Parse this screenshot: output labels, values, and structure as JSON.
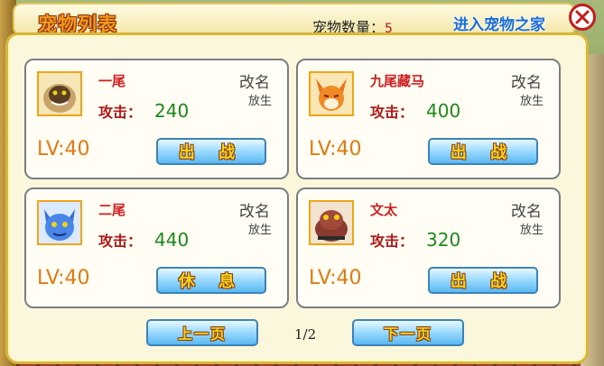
{
  "header": {
    "title": "宠物列表",
    "count_label": "宠物数量：",
    "count_value": "5",
    "home_link": "进入宠物之家"
  },
  "pets": [
    {
      "name": "一尾",
      "attack_label": "攻击：",
      "attack": "240",
      "level": "LV:40",
      "rename": "改名",
      "release": "放生",
      "action": "出 战",
      "avatar": "tanuki-icon"
    },
    {
      "name": "九尾藏马",
      "attack_label": "攻击：",
      "attack": "400",
      "level": "LV:40",
      "rename": "改名",
      "release": "放生",
      "action": "出 战",
      "avatar": "fox-icon"
    },
    {
      "name": "二尾",
      "attack_label": "攻击：",
      "attack": "440",
      "level": "LV:40",
      "rename": "改名",
      "release": "放生",
      "action": "休 息",
      "avatar": "cat-icon"
    },
    {
      "name": "文太",
      "attack_label": "攻击：",
      "attack": "320",
      "level": "LV:40",
      "rename": "改名",
      "release": "放生",
      "action": "出 战",
      "avatar": "toad-icon"
    }
  ],
  "pager": {
    "prev": "上一页",
    "next": "下一页",
    "page": "1/2"
  },
  "colors": {
    "accent_orange": "#f29a1e",
    "attack_green": "#1a8a1a",
    "name_red": "#d21e1e",
    "button_blue": "#5cb8f2",
    "link_blue": "#1a6dd6"
  }
}
